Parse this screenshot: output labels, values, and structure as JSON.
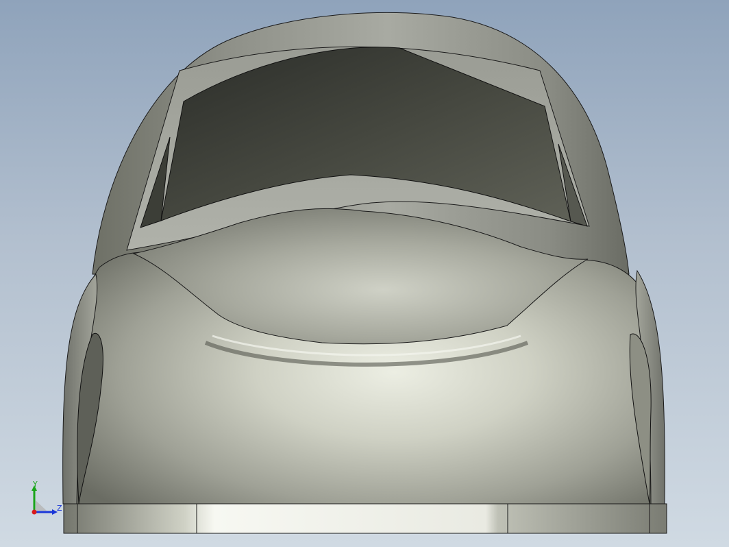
{
  "viewport": {
    "background_top": "#8fa3bb",
    "background_bottom": "#d0dae3",
    "model_subject": "car-body-front-view"
  },
  "triad": {
    "y_label": "Y",
    "z_label": "Z",
    "y_color": "#1aa51a",
    "z_color": "#1a36d8",
    "x_color": "#d81a1a"
  }
}
